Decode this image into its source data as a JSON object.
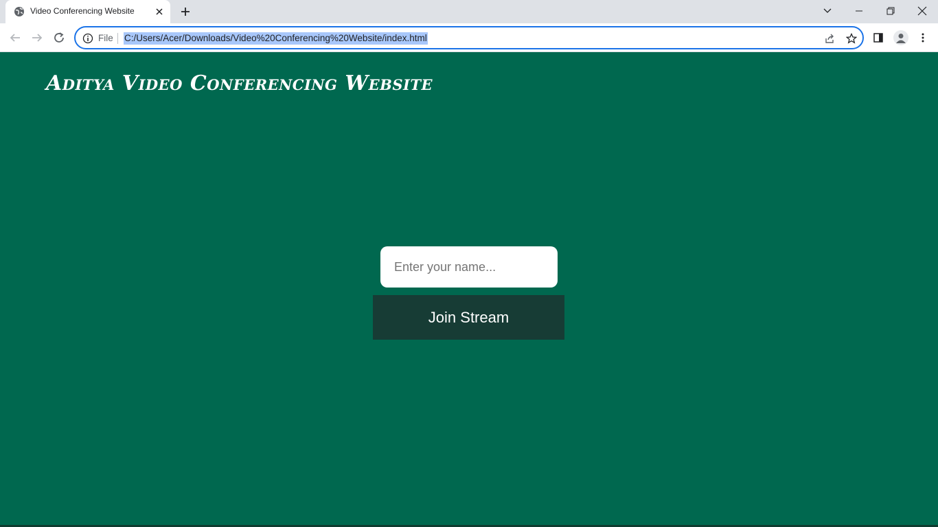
{
  "browser": {
    "tab_title": "Video Conferencing Website",
    "file_chip": "File",
    "url": "C:/Users/Acer/Downloads/Video%20Conferencing%20Website/index.html"
  },
  "page": {
    "title": "Aditya Video Conferencing Website",
    "name_placeholder": "Enter your name...",
    "join_button": "Join Stream"
  },
  "colors": {
    "background": "#00684f",
    "join_button_bg": "#173c35",
    "omnibox_focus": "#1a73e8"
  },
  "icons": {
    "favicon": "globe-icon",
    "close": "close-icon",
    "new_tab": "plus-icon",
    "back": "back-arrow-icon",
    "forward": "forward-arrow-icon",
    "reload": "reload-icon",
    "site_info": "info-icon",
    "share": "share-icon",
    "bookmark": "star-icon",
    "side_panel": "side-panel-icon",
    "profile": "profile-icon",
    "menu": "kebab-menu-icon"
  }
}
